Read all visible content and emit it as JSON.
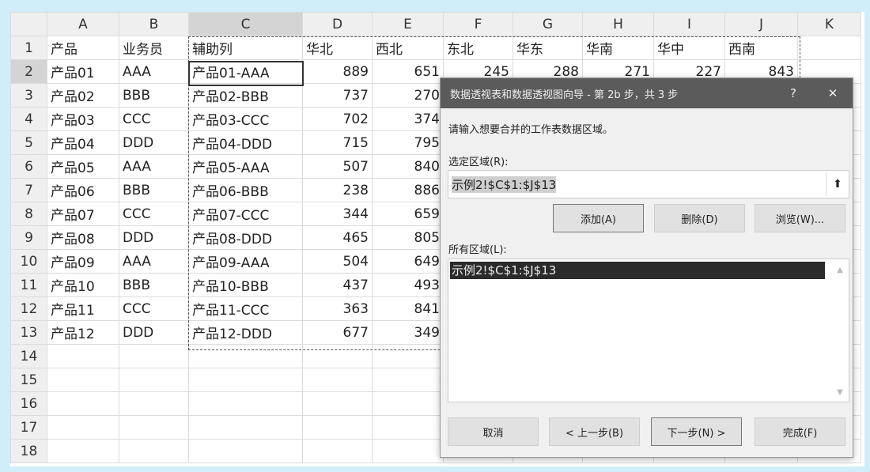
{
  "columns": [
    "A",
    "B",
    "C",
    "D",
    "E",
    "F",
    "G",
    "H",
    "I",
    "J",
    "K"
  ],
  "rows": [
    [
      "产品",
      "业务员",
      "辅助列",
      "华北",
      "西北",
      "东北",
      "华东",
      "华南",
      "华中",
      "西南",
      ""
    ],
    [
      "产品01",
      "AAA",
      "产品01-AAA",
      "889",
      "651",
      "245",
      "288",
      "271",
      "227",
      "843",
      ""
    ],
    [
      "产品02",
      "BBB",
      "产品02-BBB",
      "737",
      "270",
      "",
      "",
      "",
      "",
      "",
      ""
    ],
    [
      "产品03",
      "CCC",
      "产品03-CCC",
      "702",
      "374",
      "",
      "",
      "",
      "",
      "",
      ""
    ],
    [
      "产品04",
      "DDD",
      "产品04-DDD",
      "715",
      "795",
      "",
      "",
      "",
      "",
      "",
      ""
    ],
    [
      "产品05",
      "AAA",
      "产品05-AAA",
      "507",
      "840",
      "",
      "",
      "",
      "",
      "",
      ""
    ],
    [
      "产品06",
      "BBB",
      "产品06-BBB",
      "238",
      "886",
      "",
      "",
      "",
      "",
      "",
      ""
    ],
    [
      "产品07",
      "CCC",
      "产品07-CCC",
      "344",
      "659",
      "",
      "",
      "",
      "",
      "",
      ""
    ],
    [
      "产品08",
      "DDD",
      "产品08-DDD",
      "465",
      "805",
      "",
      "",
      "",
      "",
      "",
      ""
    ],
    [
      "产品09",
      "AAA",
      "产品09-AAA",
      "504",
      "649",
      "",
      "",
      "",
      "",
      "",
      ""
    ],
    [
      "产品10",
      "BBB",
      "产品10-BBB",
      "437",
      "493",
      "",
      "",
      "",
      "",
      "",
      ""
    ],
    [
      "产品11",
      "CCC",
      "产品11-CCC",
      "363",
      "841",
      "",
      "",
      "",
      "",
      "",
      ""
    ],
    [
      "产品12",
      "DDD",
      "产品12-DDD",
      "677",
      "349",
      "",
      "",
      "",
      "",
      "",
      ""
    ],
    [
      "",
      "",
      "",
      "",
      "",
      "",
      "",
      "",
      "",
      "",
      ""
    ],
    [
      "",
      "",
      "",
      "",
      "",
      "",
      "",
      "",
      "",
      "",
      ""
    ],
    [
      "",
      "",
      "",
      "",
      "",
      "",
      "",
      "",
      "",
      "",
      ""
    ],
    [
      "",
      "",
      "",
      "",
      "",
      "",
      "",
      "",
      "",
      "",
      ""
    ],
    [
      "",
      "",
      "",
      "",
      "",
      "",
      "",
      "",
      "",
      "",
      ""
    ]
  ],
  "dialog": {
    "title": "数据透视表和数据透视图向导 - 第 2b 步，共 3 步",
    "help": "?",
    "close": "✕",
    "prompt": "请输入想要合并的工作表数据区域。",
    "range_label": "选定区域(R):",
    "range_value": "示例2!$C$1:$J$13",
    "collapse_icon": "⬆",
    "add": "添加(A)",
    "delete": "删除(D)",
    "browse": "浏览(W)...",
    "all_label": "所有区域(L):",
    "all_ranges": [
      "示例2!$C$1:$J$13"
    ],
    "cancel": "取消",
    "back": "< 上一步(B)",
    "next": "下一步(N) >",
    "finish": "完成(F)"
  }
}
